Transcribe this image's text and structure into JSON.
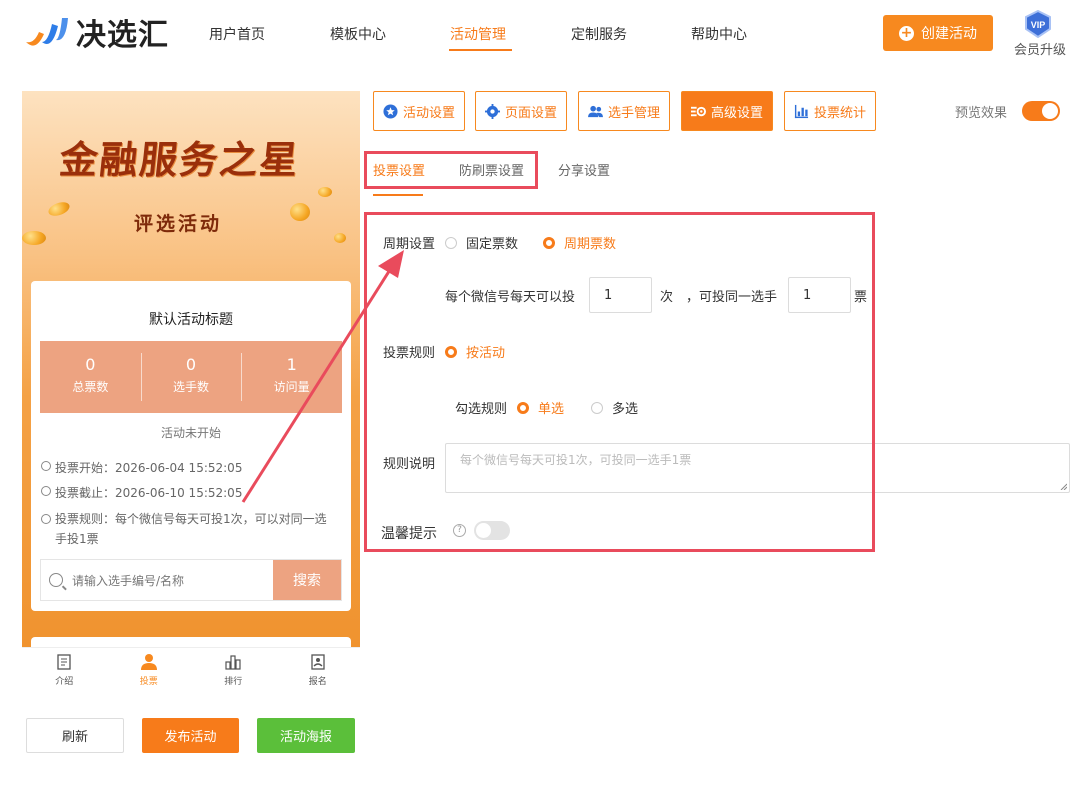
{
  "brand": {
    "name": "决选汇"
  },
  "nav": [
    {
      "label": "用户首页"
    },
    {
      "label": "模板中心"
    },
    {
      "label": "活动管理"
    },
    {
      "label": "定制服务"
    },
    {
      "label": "帮助中心"
    }
  ],
  "header": {
    "create_label": "创建活动",
    "vip_badge": "VIP",
    "vip_label": "会员升级"
  },
  "preview": {
    "banner_title": "金融服务之星",
    "banner_subtitle": "评选活动",
    "activity_title": "默认活动标题",
    "stats": [
      {
        "value": "0",
        "label": "总票数"
      },
      {
        "value": "0",
        "label": "选手数"
      },
      {
        "value": "1",
        "label": "访问量"
      }
    ],
    "status": "活动未开始",
    "vote_start": "投票开始：2026-06-04 15:52:05",
    "vote_end": "投票截止：2026-06-10 15:52:05",
    "vote_rule": "投票规则：每个微信号每天可投1次，可以对同一选手投1票",
    "search_placeholder": "请输入选手编号/名称",
    "search_button": "搜索",
    "tabs": [
      {
        "label": "介绍",
        "icon": "doc-icon"
      },
      {
        "label": "投票",
        "icon": "person-icon"
      },
      {
        "label": "排行",
        "icon": "bars-icon"
      },
      {
        "label": "报名",
        "icon": "form-icon"
      }
    ]
  },
  "actions": {
    "refresh": "刷新",
    "publish": "发布活动",
    "poster": "活动海报"
  },
  "settings_tabs": [
    {
      "label": "活动设置",
      "icon": "star-icon"
    },
    {
      "label": "页面设置",
      "icon": "gear-icon"
    },
    {
      "label": "选手管理",
      "icon": "users-icon"
    },
    {
      "label": "高级设置",
      "icon": "advanced-settings-icon"
    },
    {
      "label": "投票统计",
      "icon": "chart-icon"
    }
  ],
  "preview_toggle": {
    "label": "预览效果",
    "on": true
  },
  "sub_tabs": [
    {
      "label": "投票设置"
    },
    {
      "label": "防刷票设置"
    },
    {
      "label": "分享设置"
    }
  ],
  "form": {
    "period_label": "周期设置",
    "period_options": [
      {
        "label": "固定票数"
      },
      {
        "label": "周期票数"
      }
    ],
    "daily_prefix": "每个微信号每天可以投",
    "daily_value": "1",
    "daily_unit": "次",
    "same_prefix": "，可投同一选手",
    "same_value": "1",
    "same_unit": "票",
    "rule_label": "投票规则",
    "rule_option": "按活动",
    "select_rule_label": "勾选规则",
    "select_options": [
      {
        "label": "单选"
      },
      {
        "label": "多选"
      }
    ],
    "desc_label": "规则说明",
    "desc_placeholder": "每个微信号每天可投1次，可投同一选手1票",
    "tip_label": "温馨提示",
    "tip_help": "?"
  },
  "colors": {
    "accent": "#f77b1a",
    "highlight": "#e94b5c",
    "stats_bg": "#eda381",
    "poster_green": "#5bbf3a"
  }
}
